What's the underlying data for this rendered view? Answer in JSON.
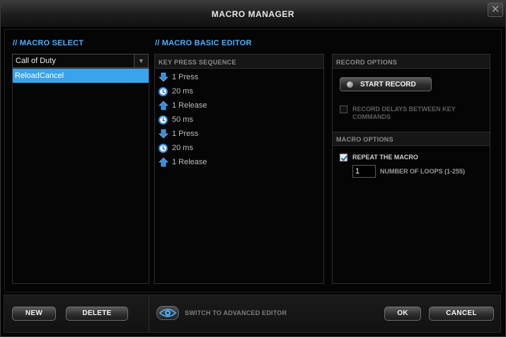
{
  "window": {
    "title": "MACRO MANAGER",
    "close_glyph": "✕"
  },
  "macro_select": {
    "heading": "// MACRO SELECT",
    "dropdown_value": "Call of Duty",
    "dropdown_arrow": "▼",
    "macros": [
      {
        "name": "ReloadCancel",
        "selected": true
      }
    ]
  },
  "basic_editor": {
    "heading": "// MACRO BASIC EDITOR",
    "sequence_header": "KEY PRESS SEQUENCE",
    "sequence": [
      {
        "icon": "arrow-down-icon",
        "text": "1 Press"
      },
      {
        "icon": "clock-icon",
        "text": "20 ms"
      },
      {
        "icon": "arrow-up-icon",
        "text": "1 Release"
      },
      {
        "icon": "clock-icon",
        "text": "50 ms"
      },
      {
        "icon": "arrow-down-icon",
        "text": "1 Press"
      },
      {
        "icon": "clock-icon",
        "text": "20 ms"
      },
      {
        "icon": "arrow-up-icon",
        "text": "1 Release"
      }
    ]
  },
  "record_options": {
    "header": "RECORD OPTIONS",
    "start_record_label": "START RECORD",
    "record_delays_label": "RECORD DELAYS BETWEEN KEY COMMANDS",
    "record_delays_checked": false
  },
  "macro_options": {
    "header": "MACRO OPTIONS",
    "repeat_label": "REPEAT THE MACRO",
    "repeat_checked": true,
    "loops_value": "1",
    "loops_label": "NUMBER OF LOOPS (1-255)"
  },
  "footer": {
    "new_label": "NEW",
    "delete_label": "DELETE",
    "switch_label": "SWITCH TO ADVANCED EDITOR",
    "ok_label": "OK",
    "cancel_label": "CANCEL"
  },
  "colors": {
    "accent": "#39a3ec",
    "heading_blue": "#4db0ff",
    "icon_blue": "#2f8fe0"
  }
}
